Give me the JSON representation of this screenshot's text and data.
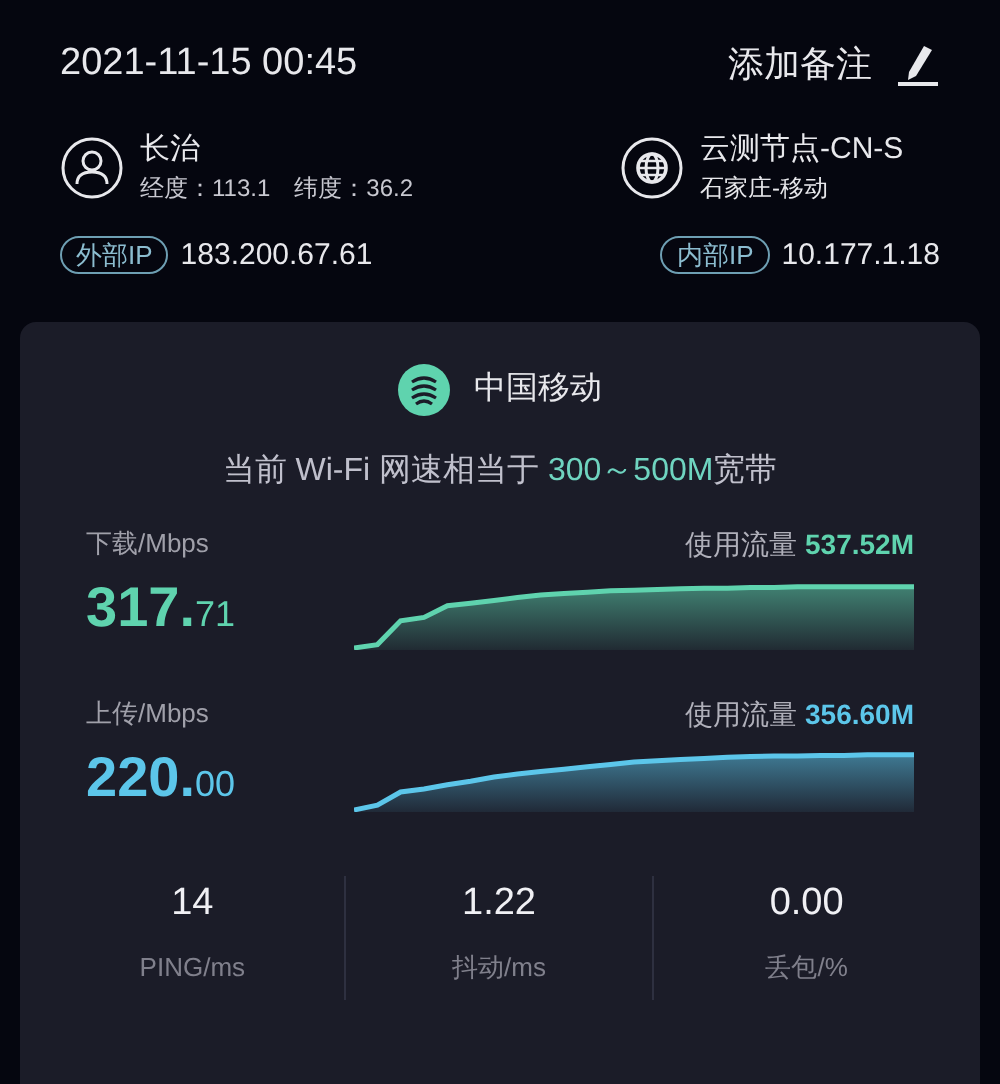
{
  "header": {
    "date_time": "2021-11-15  00:45",
    "note_button": "添加备注"
  },
  "location": {
    "name": "长治",
    "longitude": "经度：113.1",
    "latitude": "纬度：36.2"
  },
  "node": {
    "name": "云测节点-CN-S",
    "region": "石家庄-移动"
  },
  "ips": [
    {
      "label": "外部IP",
      "value": "183.200.67.61"
    },
    {
      "label": "内部IP",
      "value": "10.177.1.18"
    }
  ],
  "card": {
    "carrier": "中国移动",
    "summary": {
      "prefix": "当前 Wi-Fi 网速相当于",
      "highlight": "300～500M",
      "suffix": "宽带"
    }
  },
  "speeds": [
    {
      "kind": "download",
      "label": "下载/Mbps",
      "integer": "317.",
      "decimal": "71",
      "usage_label": "使用流量",
      "usage_value": "537.52M",
      "color": "#5fd3ae"
    },
    {
      "kind": "upload",
      "label": "上传/Mbps",
      "integer": "220.",
      "decimal": "00",
      "usage_label": "使用流量",
      "usage_value": "356.60M",
      "color": "#5cc6ea"
    }
  ],
  "stats": [
    {
      "value": "14",
      "label": "PING/ms"
    },
    {
      "value": "1.22",
      "label": "抖动/ms"
    },
    {
      "value": "0.00",
      "label": "丢包/%"
    }
  ]
}
